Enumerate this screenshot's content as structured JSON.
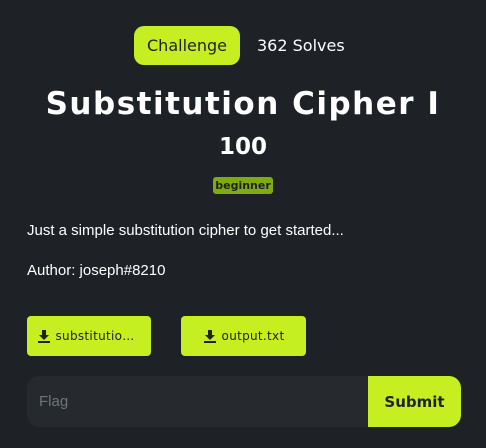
{
  "tabs": {
    "challenge_label": "Challenge",
    "solves_label": "362 Solves"
  },
  "challenge": {
    "title": "Substitution Cipher I",
    "points": "100",
    "tag": "beginner",
    "description": "Just a simple substitution cipher to get started...",
    "author": "Author: joseph#8210"
  },
  "files": [
    {
      "label": "substitution...",
      "icon": "download-icon"
    },
    {
      "label": "output.txt",
      "icon": "download-icon"
    }
  ],
  "flag_form": {
    "placeholder": "Flag",
    "value": "",
    "submit_label": "Submit"
  },
  "colors": {
    "background": "#1e2226",
    "accent": "#c5ef21",
    "tag": "#7fab10",
    "input": "#262a2e"
  }
}
